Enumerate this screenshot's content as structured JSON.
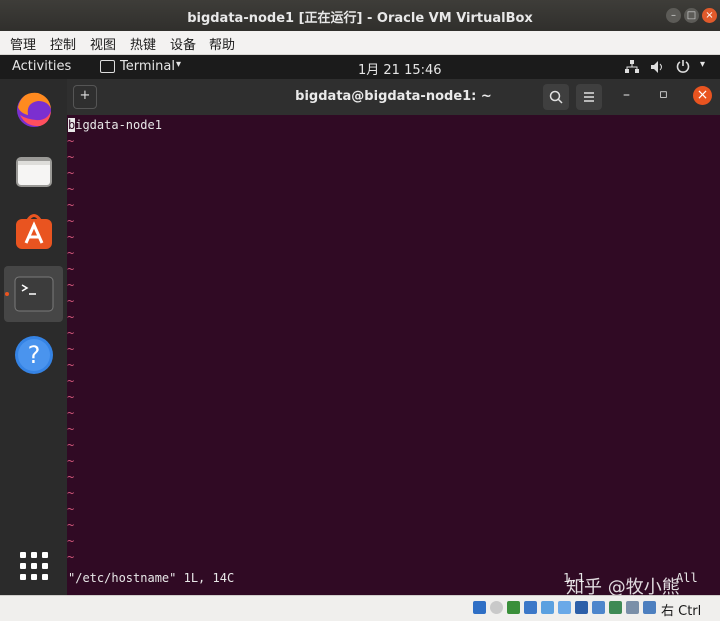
{
  "window": {
    "title": "bigdata-node1 [正在运行] - Oracle VM VirtualBox",
    "controls": {
      "minimize": "–",
      "maximize": "□",
      "close": "×"
    }
  },
  "menu": [
    "管理",
    "控制",
    "视图",
    "热键",
    "设备",
    "帮助"
  ],
  "topbar": {
    "activities": "Activities",
    "app_menu": "Terminal",
    "datetime": "1月 21  15:46"
  },
  "dock": [
    "firefox-icon",
    "files-icon",
    "software-center-icon",
    "terminal-icon",
    "help-icon",
    "app-grid-icon"
  ],
  "terminal": {
    "title": "bigdata@bigdata-node1: ~",
    "controls": {
      "minimize": "–",
      "maximize": "▫",
      "close": "×"
    },
    "content": {
      "first_char": "b",
      "first_line_rest": "igdata-node1",
      "tilde": "~",
      "status_left": "\"/etc/hostname\" 1L, 14C",
      "position": "1,1",
      "scroll": "All"
    }
  },
  "statusbar": {
    "host_key": "右 Ctrl"
  },
  "watermark": "知乎 @牧小熊"
}
